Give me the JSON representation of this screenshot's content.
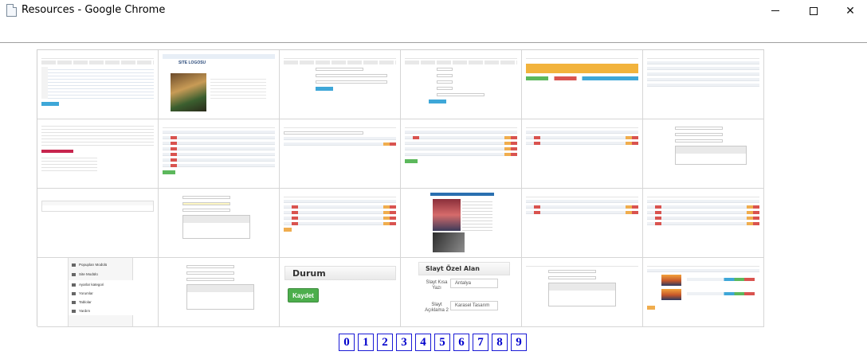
{
  "window": {
    "title": "Resources - Google Chrome",
    "close_glyph": "✕"
  },
  "thumbnails": {
    "durum_title": "Durum",
    "kaydet_label": "Kaydet",
    "slayt_title": "Slayt Özel Alan",
    "slayt_label1": "Slayt Kısa Yazı",
    "slayt_label2": "Slayt Açıklama 2",
    "slayt_value1": "Antalya",
    "slayt_value2": "Karasel Tasarım",
    "menu_item1": "Popupları Modülü",
    "menu_item2": "Site Modülü",
    "menu_item3": "Ayarlar kategori",
    "menu_item4": "Yorumlar",
    "menu_item5": "Tablolar",
    "menu_item6": "Yardım",
    "logo_text": "SITE LOGOSU"
  },
  "pagination": [
    "0",
    "1",
    "2",
    "3",
    "4",
    "5",
    "6",
    "7",
    "8",
    "9"
  ],
  "colors": {
    "accent_green": "#4cae4c",
    "link_blue": "#0000cc",
    "orange": "#f2b33c",
    "danger": "#d9534f"
  }
}
